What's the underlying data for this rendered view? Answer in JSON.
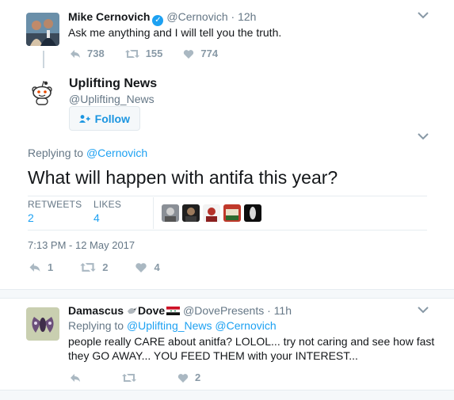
{
  "tweet1": {
    "name": "Mike Cernovich",
    "handle": "@Cernovich",
    "time": "· 12h",
    "text": "Ask me anything and I will tell you the truth.",
    "replies": "738",
    "retweets": "155",
    "likes": "774"
  },
  "main": {
    "name": "Uplifting News",
    "handle": "@Uplifting_News",
    "follow_label": "Follow",
    "replying_label": "Replying to",
    "replying_handle": "@Cernovich",
    "text": "What will happen with antifa this year?",
    "retweets_label": "RETWEETS",
    "retweets_value": "2",
    "likes_label": "LIKES",
    "likes_value": "4",
    "timestamp": "7:13 PM - 12 May 2017",
    "replies": "1",
    "retweets": "2",
    "likes": "4"
  },
  "reply": {
    "name": "Damascus",
    "name_suffix": "Dove",
    "handle": "@DovePresents",
    "time": "· 11h",
    "replying_label": "Replying to",
    "replying_handles": "@Uplifting_News @Cernovich",
    "text_line1": "people really CARE about anitfa? LOLOL... try not caring and see how fast",
    "text_line2": "they GO AWAY...  YOU FEED THEM with your INTEREST...",
    "likes": "2"
  },
  "colors": {
    "accent": "#1da1f2",
    "muted": "#657786",
    "divider": "#e6ecf0"
  },
  "icons": [
    "verified-badge-icon",
    "reply-icon",
    "retweet-icon",
    "heart-icon",
    "add-user-icon",
    "chevron-down-icon",
    "reddit-alien-icon",
    "dove-emoji-icon",
    "flag-emoji-icon"
  ]
}
